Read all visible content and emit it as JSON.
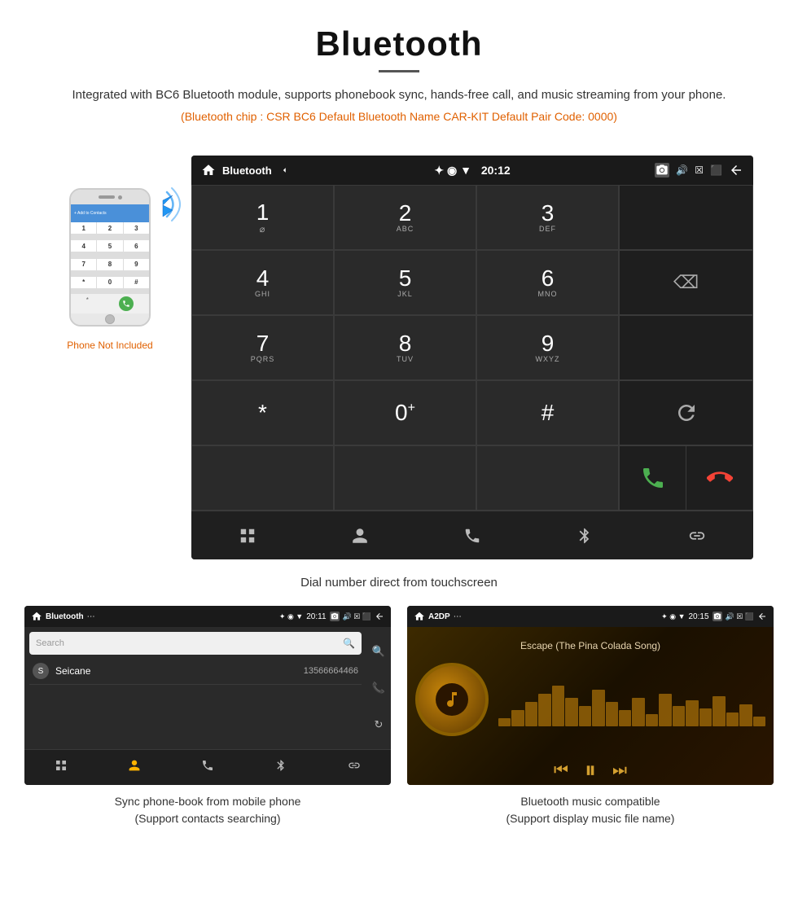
{
  "header": {
    "title": "Bluetooth",
    "divider": true,
    "description": "Integrated with BC6 Bluetooth module, supports phonebook sync, hands-free call, and music streaming from your phone.",
    "specs": "(Bluetooth chip : CSR BC6    Default Bluetooth Name CAR-KIT    Default Pair Code: 0000)"
  },
  "main_demo": {
    "phone_label": "Phone Not Included",
    "screen_title": "Bluetooth",
    "time": "20:12",
    "caption": "Dial number direct from touchscreen",
    "dialpad": {
      "keys": [
        {
          "num": "1",
          "sub": "⌀"
        },
        {
          "num": "2",
          "sub": "ABC"
        },
        {
          "num": "3",
          "sub": "DEF"
        },
        {
          "num": "4",
          "sub": "GHI"
        },
        {
          "num": "5",
          "sub": "JKL"
        },
        {
          "num": "6",
          "sub": "MNO"
        },
        {
          "num": "7",
          "sub": "PQRS"
        },
        {
          "num": "8",
          "sub": "TUV"
        },
        {
          "num": "9",
          "sub": "WXYZ"
        },
        {
          "num": "*",
          "sub": ""
        },
        {
          "num": "0",
          "sub": "+"
        },
        {
          "num": "#",
          "sub": ""
        }
      ]
    }
  },
  "phonebook_screen": {
    "status_title": "Bluetooth",
    "time": "20:11",
    "search_placeholder": "Search",
    "contacts": [
      {
        "letter": "S",
        "name": "Seicane",
        "number": "13566664466"
      }
    ],
    "caption_line1": "Sync phone-book from mobile phone",
    "caption_line2": "(Support contacts searching)"
  },
  "music_screen": {
    "status_title": "A2DP",
    "time": "20:15",
    "song_title": "Escape (The Pina Colada Song)",
    "caption_line1": "Bluetooth music compatible",
    "caption_line2": "(Support display music file name)"
  },
  "nav_icons": {
    "grid": "⊞",
    "person": "👤",
    "phone": "📞",
    "bluetooth": "✦",
    "link": "🔗"
  }
}
